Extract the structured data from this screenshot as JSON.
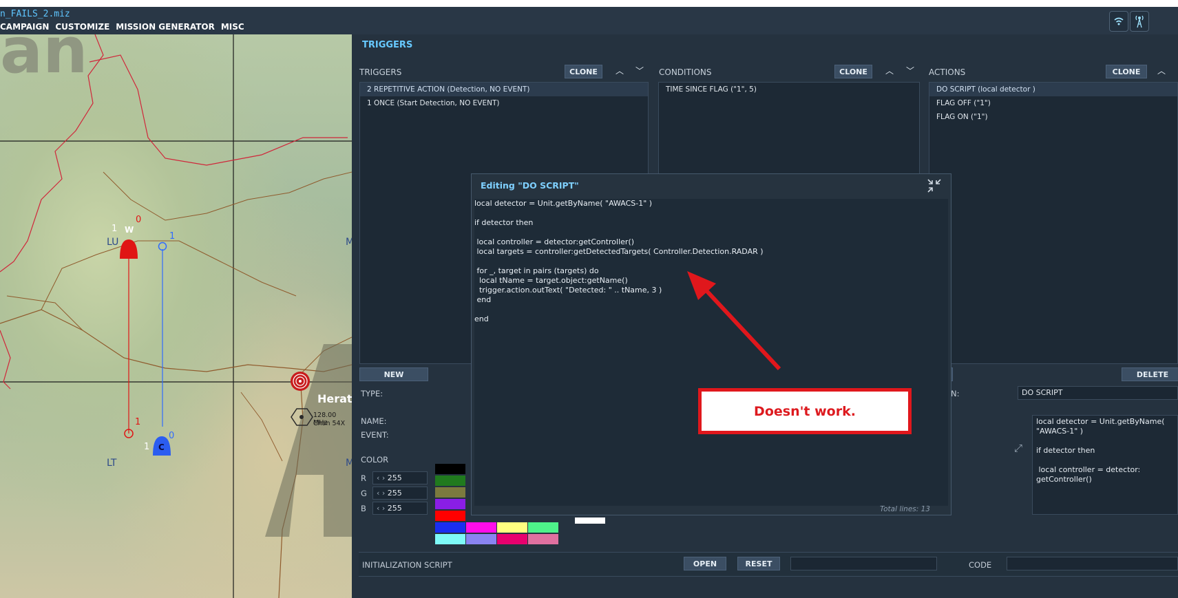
{
  "window": {
    "filename": "n_FAILS_2.miz",
    "menu": [
      "CAMPAIGN",
      "CUSTOMIZE",
      "MISSION GENERATOR",
      "MISC"
    ]
  },
  "map": {
    "watermark": "an",
    "city": "Herat",
    "freq_label": "128.00 MHz",
    "chan_label": "Chan 54X",
    "labels": [
      "LU",
      "LT",
      "M",
      "M"
    ],
    "markers": {
      "w_letter": "W",
      "w_index": "1",
      "w_count": "0",
      "w_end": "1",
      "c_letter": "C",
      "c_index": "1",
      "c_count": "0",
      "c_end": "1"
    }
  },
  "triggers": {
    "title": "TRIGGERS",
    "col_triggers": "TRIGGERS",
    "col_conditions": "CONDITIONS",
    "col_actions": "ACTIONS",
    "clone_label": "CLONE",
    "triggers_list": [
      "2 REPETITIVE ACTION (Detection, NO EVENT)",
      "1 ONCE (Start Detection, NO EVENT)"
    ],
    "conditions_list": [
      "TIME SINCE FLAG (\"1\", 5)"
    ],
    "actions_list": [
      "DO SCRIPT (local detector )",
      "FLAG OFF (\"1\")",
      "FLAG ON (\"1\")"
    ],
    "new_label": "NEW",
    "delete_label": "DELETE",
    "type_label": "TYPE:",
    "name_label": "NAME:",
    "event_label": "EVENT:",
    "color_label": "COLOR",
    "r_label": "R",
    "g_label": "G",
    "b_label": "B",
    "r_value": "255",
    "g_value": "255",
    "b_value": "255",
    "action_label": "N:",
    "action_value": "DO SCRIPT",
    "script_preview": "local detector = Unit.getByName(\n\"AWACS-1\" )\n\nif detector then\n\n local controller = detector:\ngetController()",
    "init_script_label": "INITIALIZATION SCRIPT",
    "open_label": "OPEN",
    "reset_label": "RESET",
    "code_label": "CODE"
  },
  "editor": {
    "title": "Editing \"DO SCRIPT\"",
    "code": "local detector = Unit.getByName( \"AWACS-1\" )\n\nif detector then\n\n local controller = detector:getController()\n local targets = controller:getDetectedTargets( Controller.Detection.RADAR )\n\n for _, target in pairs (targets) do\n  local tName = target.object:getName()\n  trigger.action.outText( \"Detected: \" .. tName, 3 )\n end\n\nend",
    "total_lines": "Total lines:  13"
  },
  "annotation": {
    "text": "Doesn't work.",
    "color": "#e0171c"
  },
  "colors": {
    "palette": [
      "#000000",
      "#207a1e",
      "#7b7a3e",
      "#8a1ee6",
      "#ff0000",
      "#1a2ef0",
      "#7efaf8",
      "#ff0dea",
      "#ffff80",
      "#4ef28a",
      "#8a84f2",
      "#e8006e",
      "#e070a0",
      "#ffffff"
    ]
  }
}
